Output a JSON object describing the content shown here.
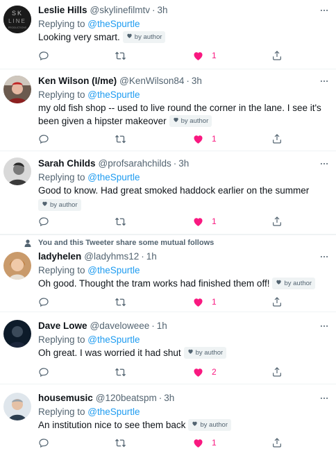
{
  "reply_to_prefix": "Replying to ",
  "badge_label": "by author",
  "colors": {
    "accent": "#1d9bf0",
    "like": "#f91880",
    "muted": "#536471"
  },
  "social_context": "You and this Tweeter share some mutual follows",
  "tweets": [
    {
      "name": "Leslie Hills",
      "handle": "@skylinefilmtv",
      "time": "3h",
      "reply_to": "@theSpurtle",
      "text": "Looking very smart.",
      "likes": "1",
      "avatar_text": [
        "SK",
        "LINE",
        "PRODUCTIONS"
      ]
    },
    {
      "name": "Ken Wilson (I/me)",
      "handle": "@KenWilson84",
      "time": "3h",
      "reply_to": "@theSpurtle",
      "text": "my old fish shop -- used to live round the corner in the lane. I see it's been given a hipster makeover",
      "likes": "1"
    },
    {
      "name": "Sarah Childs",
      "handle": "@profsarahchilds",
      "time": "3h",
      "reply_to": "@theSpurtle",
      "text": "Good to know. Had great smoked haddock earlier on the summer",
      "likes": "1"
    },
    {
      "name": "ladyhelen",
      "handle": "@ladyhms12",
      "time": "1h",
      "reply_to": "@theSpurtle",
      "text": "Oh good. Thought the tram works had finished them off!",
      "likes": "1"
    },
    {
      "name": "Dave Lowe",
      "handle": "@daveloweee",
      "time": "1h",
      "reply_to": "@theSpurtle",
      "text": "Oh great. I was worried it had shut",
      "likes": "2"
    },
    {
      "name": "housemusic",
      "handle": "@120beatspm",
      "time": "3h",
      "reply_to": "@theSpurtle",
      "text": "An institution nice to see them back",
      "likes": "1"
    }
  ]
}
